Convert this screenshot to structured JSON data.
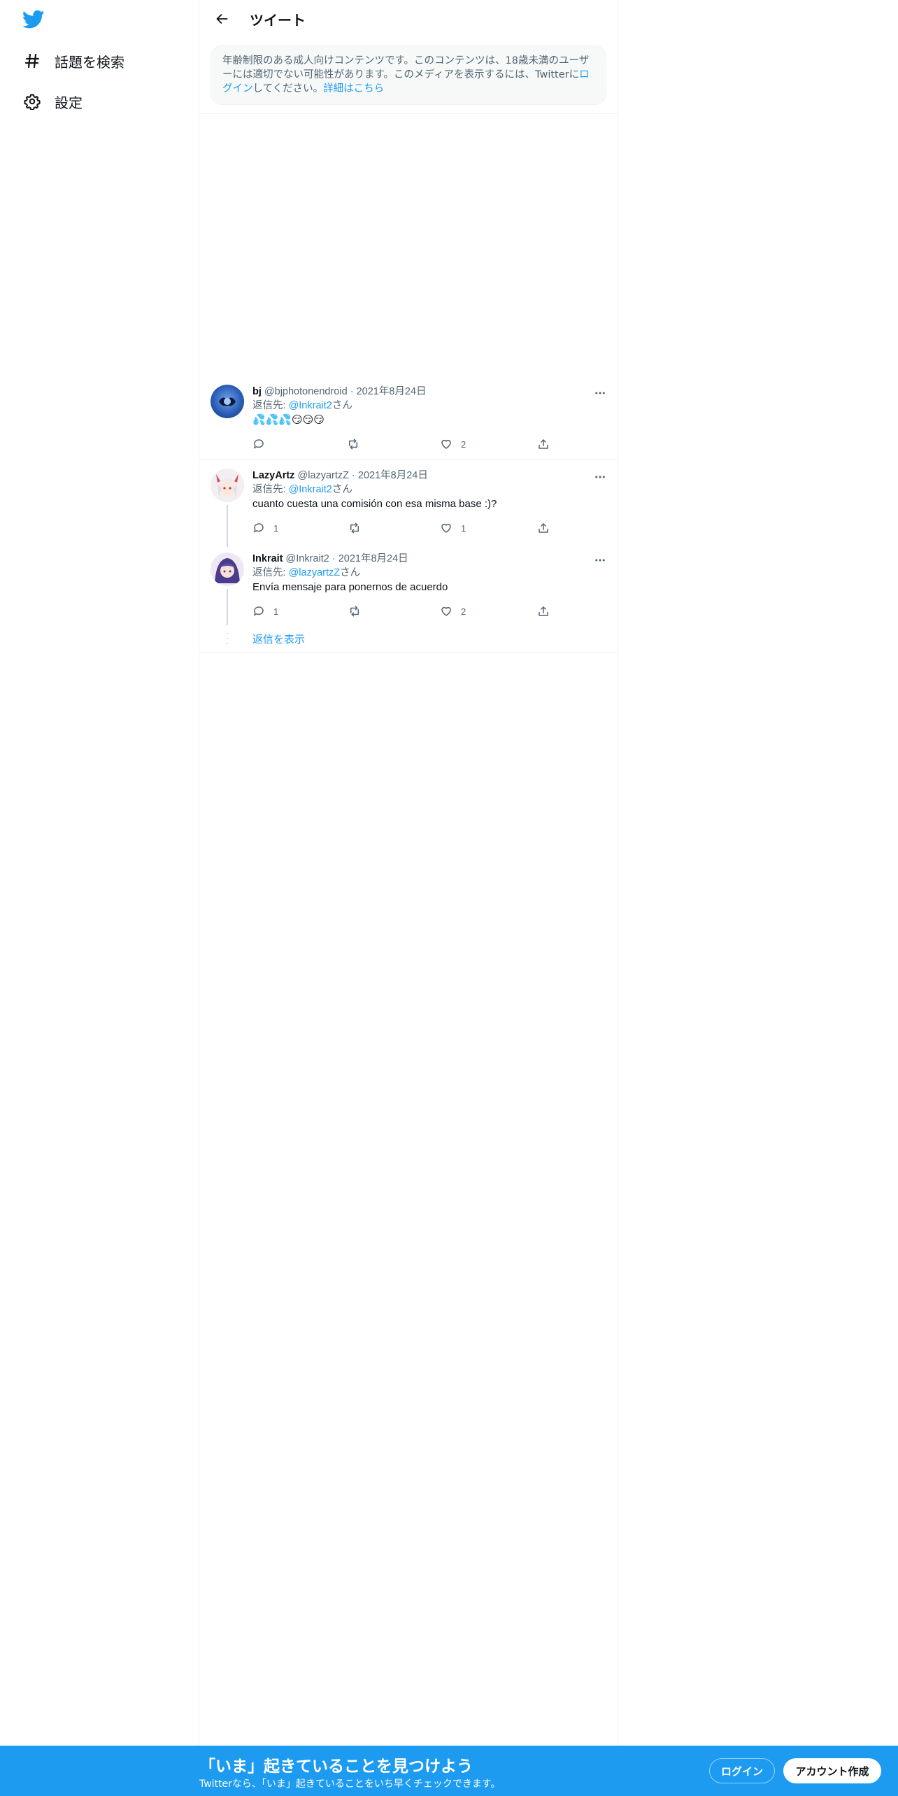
{
  "sidebar": {
    "nav": [
      {
        "label": "話題を検索",
        "icon": "hashtag-icon"
      },
      {
        "label": "設定",
        "icon": "gear-icon"
      }
    ]
  },
  "header": {
    "title": "ツイート"
  },
  "notice": {
    "text_1": "年齢制限のある成人向けコンテンツです。このコンテンツは、18歳未満のユーザーには適切でない可能性があります。このメディアを表示するには、Twitterに",
    "login_link": "ログイン",
    "text_2": "してください。",
    "details_link": "詳細はこちら"
  },
  "tweets": [
    {
      "name": "bj",
      "handle": "@bjphotonendroid",
      "date": "2021年8月24日",
      "reply_prefix": "返信先: ",
      "reply_handle": "@Inkrait2",
      "reply_suffix": "さん",
      "text": "💦💦💦😏😏😏",
      "reply_count": "",
      "retweet_count": "",
      "like_count": "2"
    },
    {
      "name": "LazyArtz",
      "handle": "@lazyartzZ",
      "date": "2021年8月24日",
      "reply_prefix": "返信先: ",
      "reply_handle": "@Inkrait2",
      "reply_suffix": "さん",
      "text": "cuanto cuesta una comisión con esa misma base :)?",
      "reply_count": "1",
      "retweet_count": "",
      "like_count": "1"
    },
    {
      "name": "Inkrait",
      "handle": "@Inkrait2",
      "date": "2021年8月24日",
      "reply_prefix": "返信先: ",
      "reply_handle": "@lazyartzZ",
      "reply_suffix": "さん",
      "text": "Envía mensaje para ponernos de acuerdo",
      "reply_count": "1",
      "retweet_count": "",
      "like_count": "2"
    }
  ],
  "show_replies": "返信を表示",
  "separator": "·",
  "bottom_bar": {
    "title": "「いま」起きていることを見つけよう",
    "subtitle": "Twitterなら、「いま」起きていることをいち早くチェックできます。",
    "login": "ログイン",
    "signup": "アカウント作成"
  },
  "colors": {
    "accent": "#1d9bf0",
    "text": "#0f1419",
    "muted": "#536471",
    "border": "#eff3f4"
  }
}
